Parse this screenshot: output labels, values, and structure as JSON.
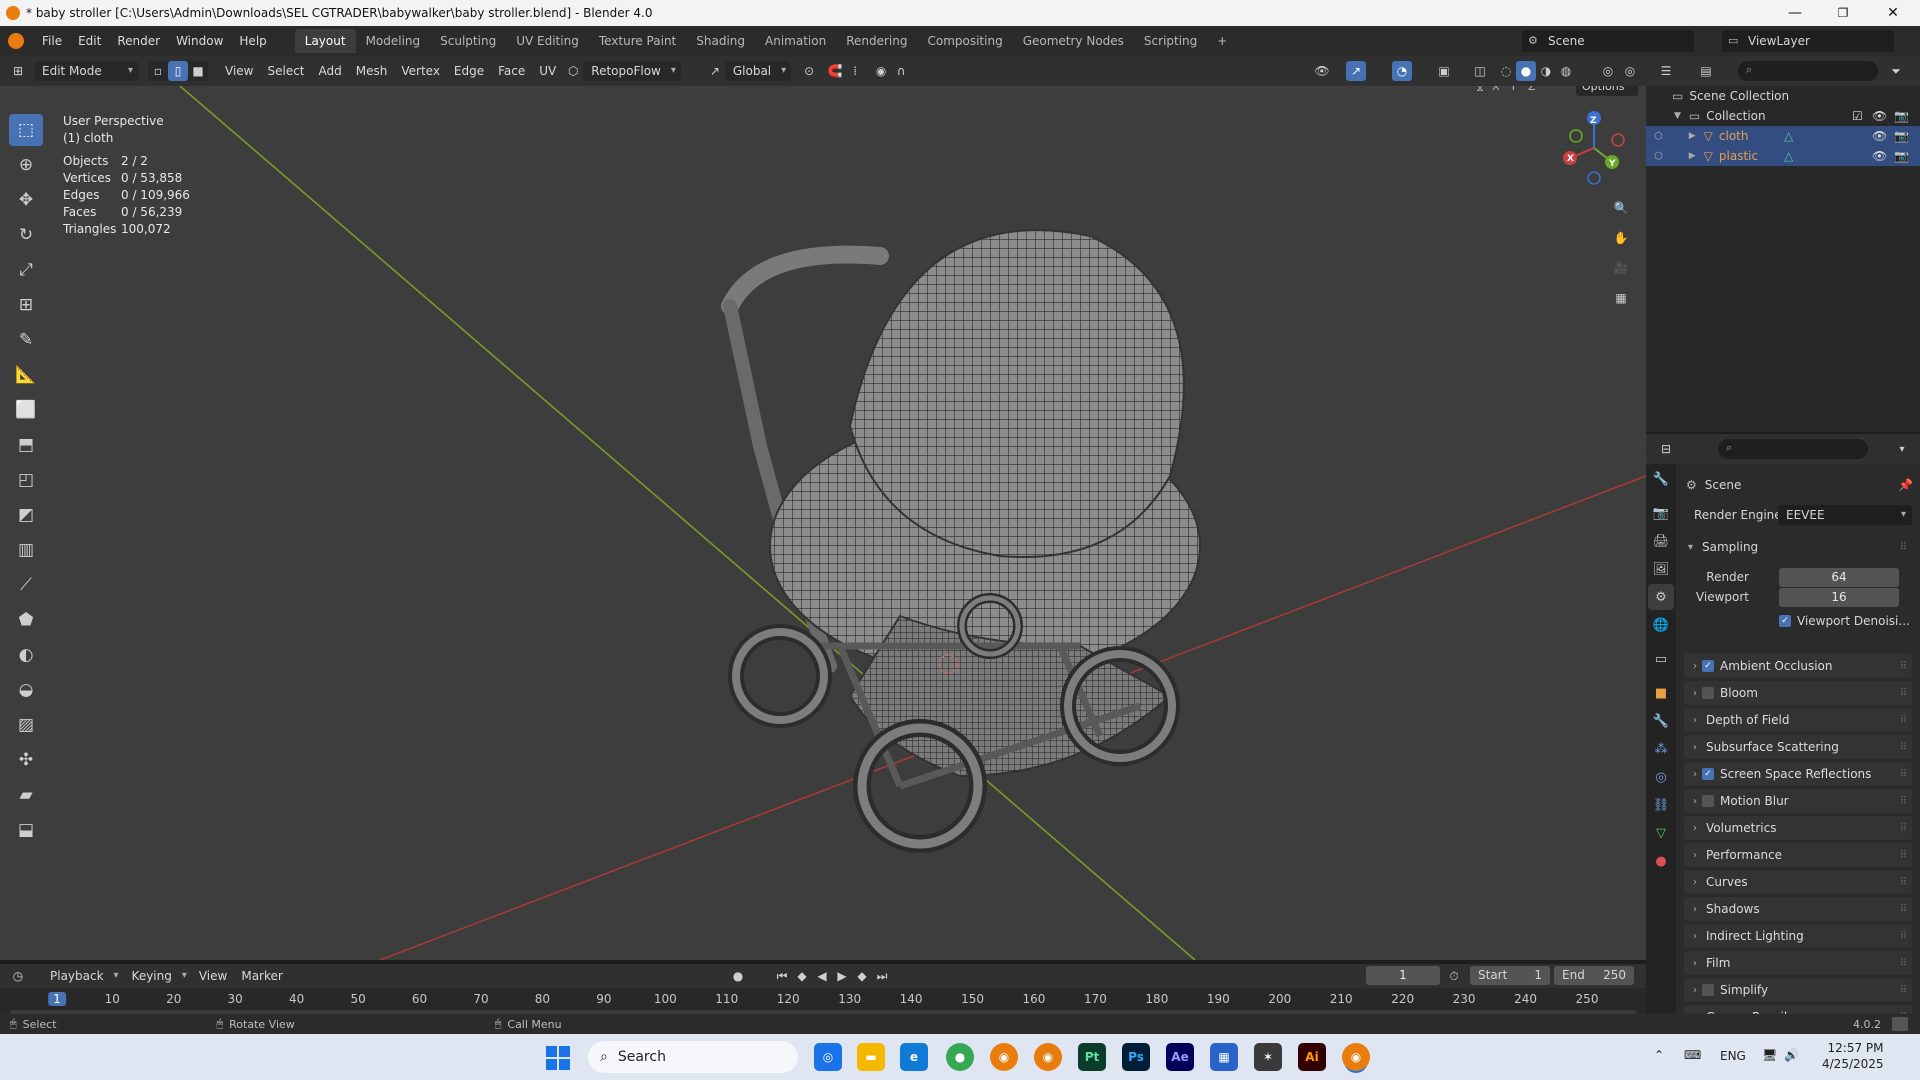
{
  "window": {
    "title": "* baby stroller [C:\\Users\\Admin\\Downloads\\SEL CGTRADER\\babywalker\\baby stroller.blend] - Blender 4.0",
    "minimize": "—",
    "maximize": "❐",
    "close": "✕"
  },
  "menu": [
    "File",
    "Edit",
    "Render",
    "Window",
    "Help"
  ],
  "workspaces": [
    "Layout",
    "Modeling",
    "Sculpting",
    "UV Editing",
    "Texture Paint",
    "Shading",
    "Animation",
    "Rendering",
    "Compositing",
    "Geometry Nodes",
    "Scripting"
  ],
  "workspace_add": "+",
  "scene_name": "Scene",
  "view_layer": "ViewLayer",
  "viewport_header": {
    "mode": "Edit Mode",
    "menus": [
      "View",
      "Select",
      "Add",
      "Mesh",
      "Vertex",
      "Edge",
      "Face",
      "UV"
    ],
    "addon": "RetopoFlow",
    "transform_orientation": "Global",
    "options_label": "Options",
    "axes": [
      "X",
      "Y",
      "Z"
    ]
  },
  "viewport_info": {
    "view_name": "User Perspective",
    "object": "(1) cloth",
    "stats": [
      {
        "k": "Objects",
        "v": "2 / 2"
      },
      {
        "k": "Vertices",
        "v": "0 / 53,858"
      },
      {
        "k": "Edges",
        "v": "0 / 109,966"
      },
      {
        "k": "Faces",
        "v": "0 / 56,239"
      },
      {
        "k": "Triangles",
        "v": "100,072"
      }
    ]
  },
  "gizmo": {
    "x": "X",
    "y": "Y",
    "z": "Z"
  },
  "outliner": {
    "root": "Scene Collection",
    "collection": "Collection",
    "objects": [
      {
        "name": "cloth",
        "color": "#e0a050"
      },
      {
        "name": "plastic",
        "color": "#e0a050"
      }
    ]
  },
  "properties": {
    "context": "Scene",
    "render_engine_label": "Render Engine",
    "render_engine": "EEVEE",
    "sampling_label": "Sampling",
    "render_label": "Render",
    "render_value": "64",
    "viewport_label": "Viewport",
    "viewport_value": "16",
    "viewport_denoise": "Viewport Denoisi...",
    "panels": [
      {
        "label": "Ambient Occlusion",
        "checkbox": true,
        "checked": true
      },
      {
        "label": "Bloom",
        "checkbox": true,
        "checked": false
      },
      {
        "label": "Depth of Field",
        "checkbox": false,
        "checked": false
      },
      {
        "label": "Subsurface Scattering",
        "checkbox": false,
        "checked": false
      },
      {
        "label": "Screen Space Reflections",
        "checkbox": true,
        "checked": true
      },
      {
        "label": "Motion Blur",
        "checkbox": true,
        "checked": false
      },
      {
        "label": "Volumetrics",
        "checkbox": false,
        "checked": false
      },
      {
        "label": "Performance",
        "checkbox": false,
        "checked": false
      },
      {
        "label": "Curves",
        "checkbox": false,
        "checked": false
      },
      {
        "label": "Shadows",
        "checkbox": false,
        "checked": false
      },
      {
        "label": "Indirect Lighting",
        "checkbox": false,
        "checked": false
      },
      {
        "label": "Film",
        "checkbox": false,
        "checked": false
      },
      {
        "label": "Simplify",
        "checkbox": true,
        "checked": false
      },
      {
        "label": "Grease Pencil",
        "checkbox": false,
        "checked": false
      }
    ]
  },
  "timeline": {
    "menus": [
      "Playback",
      "Keying",
      "View",
      "Marker"
    ],
    "current_frame": "1",
    "start_label": "Start",
    "start": "1",
    "end_label": "End",
    "end": "250",
    "ticks": [
      "1",
      "10",
      "20",
      "30",
      "40",
      "50",
      "60",
      "70",
      "80",
      "90",
      "100",
      "110",
      "120",
      "130",
      "140",
      "150",
      "160",
      "170",
      "180",
      "190",
      "200",
      "210",
      "220",
      "230",
      "240",
      "250"
    ]
  },
  "statusbar": {
    "select": "Select",
    "rotate": "Rotate View",
    "menu": "Call Menu",
    "version": "4.0.2"
  },
  "taskbar": {
    "search": "Search",
    "lang": "ENG",
    "time": "12:57 PM",
    "date": "4/25/2025",
    "apps": [
      "Pt",
      "Ps",
      "Ae",
      "Ai"
    ]
  }
}
